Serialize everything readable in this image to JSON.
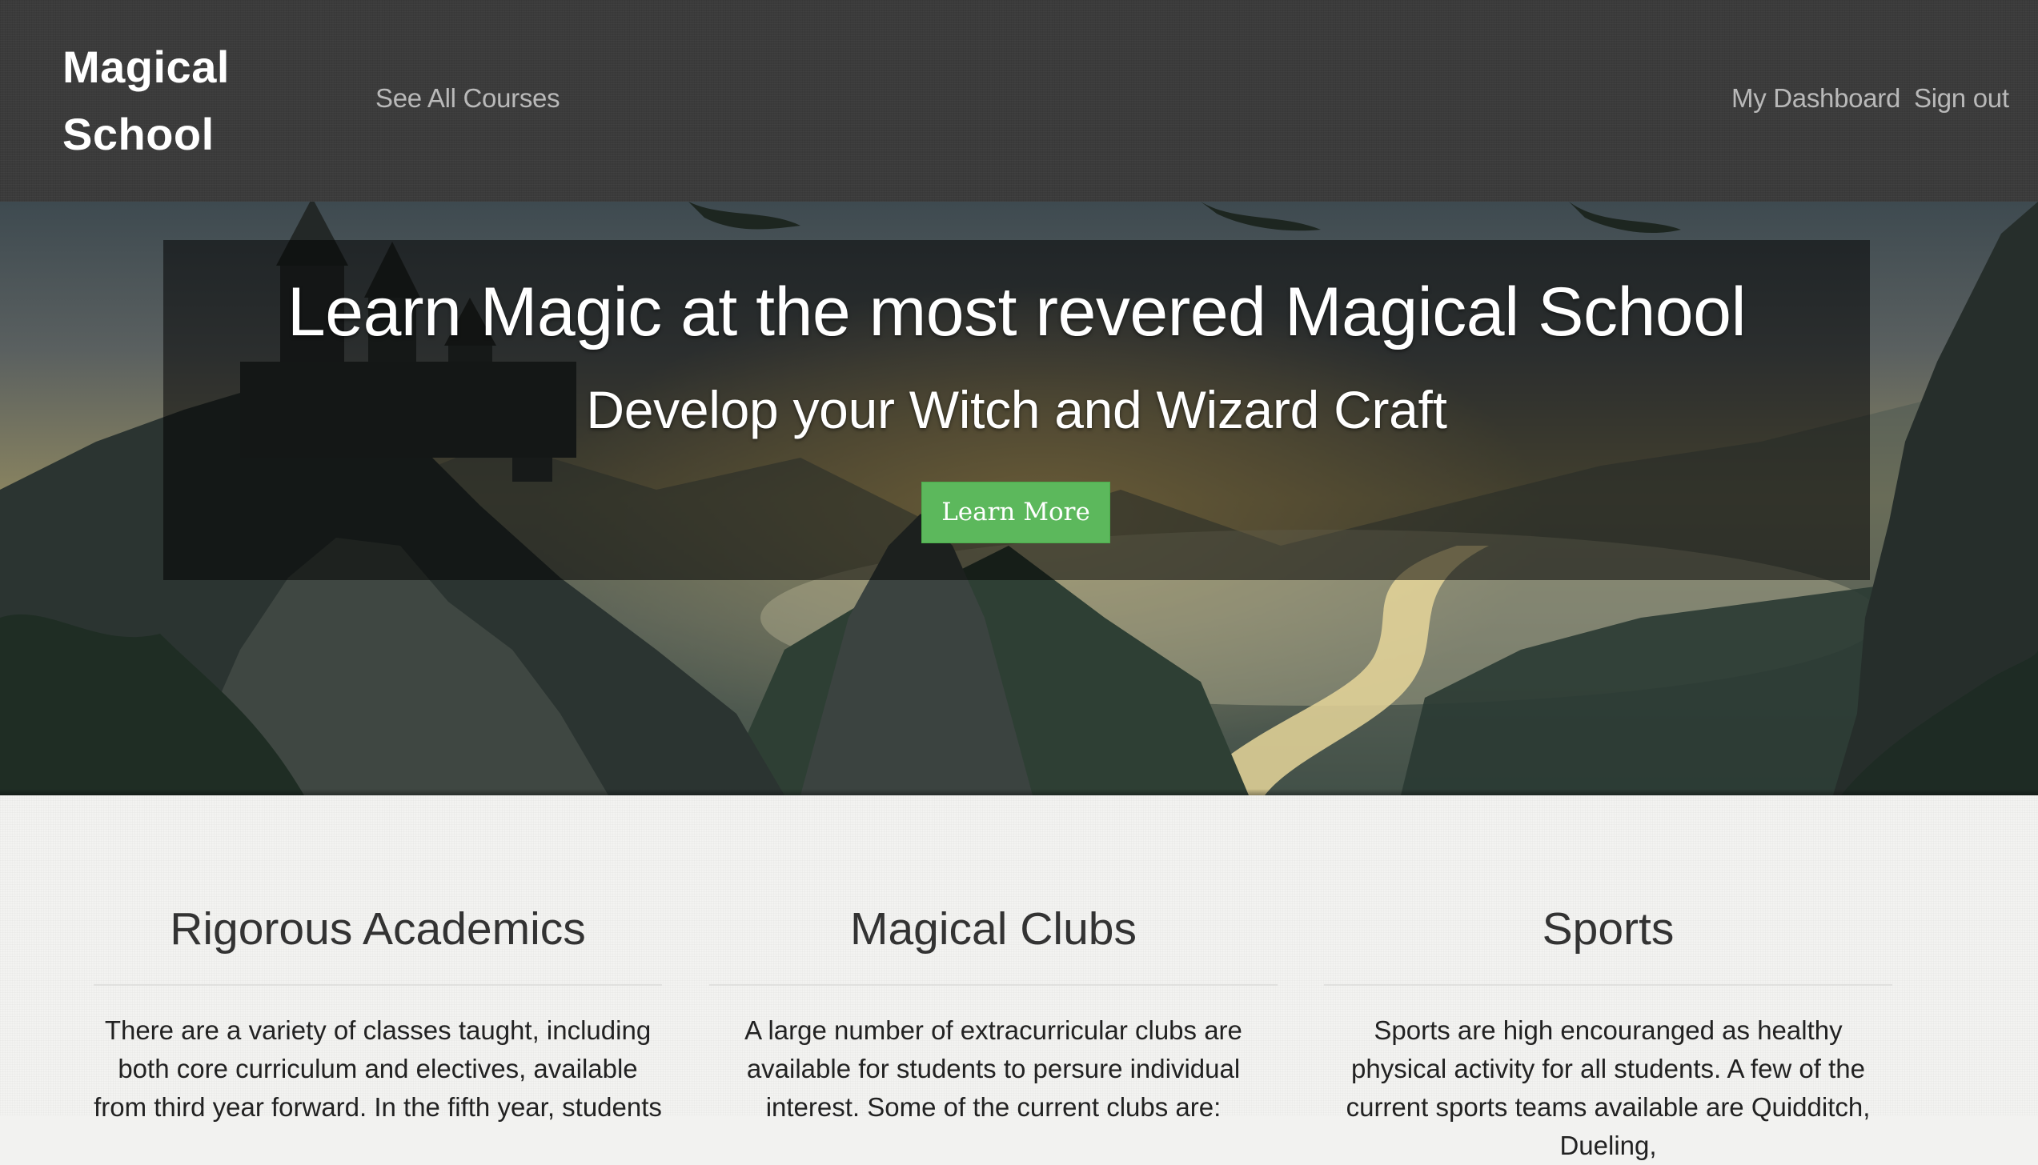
{
  "header": {
    "brand": "Magical School",
    "nav": {
      "courses_label": "See All Courses",
      "dashboard_label": "My Dashboard",
      "signout_label": "Sign out"
    }
  },
  "hero": {
    "title": "Learn Magic at the most revered Magical School",
    "subtitle": "Develop your Witch and Wizard Craft",
    "cta_label": "Learn More",
    "cta_color": "#5cb85c"
  },
  "features": [
    {
      "title": "Rigorous Academics",
      "text": "There are a variety of classes taught, including both core curriculum and electives, available from third year forward. In the fifth year, students"
    },
    {
      "title": "Magical Clubs",
      "text": "A large number of extracurricular clubs are available for students to persure individual interest. Some of the current clubs are:"
    },
    {
      "title": "Sports",
      "text": "Sports are high encouranged as healthy physical activity for all students. A few of the current sports teams available are Quidditch, Dueling,"
    }
  ],
  "colors": {
    "header_bg": "#3b3b3b",
    "nav_text": "#b9b9b9",
    "page_bg": "#f3f3f1",
    "heading_text": "#333333"
  }
}
